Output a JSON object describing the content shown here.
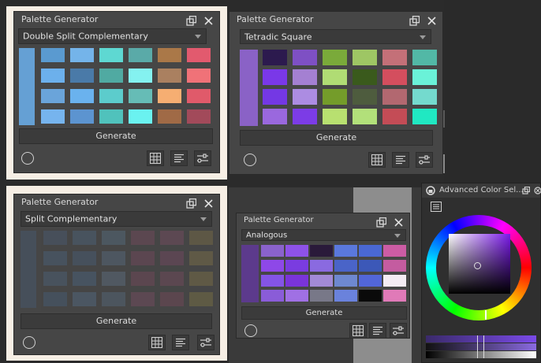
{
  "panels": [
    {
      "title": "Palette Generator",
      "harmony": "Double Split Complementary",
      "generate_label": "Generate",
      "first_color": "#65a0d4",
      "colors": [
        [
          "#5a9ad0",
          "#74b4ea",
          "#5ed8d2",
          "#5aaaa8",
          "#aa7848",
          "#e25a6e"
        ],
        [
          "#6cb0ec",
          "#4a7aa8",
          "#50aaa2",
          "#84f2f0",
          "#aa8060",
          "#f07278"
        ],
        [
          "#6aa4da",
          "#6ab2ee",
          "#5ccccc",
          "#66bcb6",
          "#f6ae72",
          "#e05a6a"
        ],
        [
          "#76b4ee",
          "#5c94d0",
          "#50c2bc",
          "#6af2f0",
          "#a06a46",
          "#a24a5a"
        ]
      ]
    },
    {
      "title": "Palette Generator",
      "harmony": "Tetradic Square",
      "generate_label": "Generate",
      "first_color": "#8a62c6",
      "colors": [
        [
          "#2c1a4e",
          "#7e50c4",
          "#7aaa3a",
          "#9ec664",
          "#c47078",
          "#52b8a6"
        ],
        [
          "#7a38e8",
          "#a480d2",
          "#b0dc74",
          "#3a5a1c",
          "#d44e5e",
          "#6af2d8"
        ],
        [
          "#7438e4",
          "#ac8ce2",
          "#749c2a",
          "#4e5c3e",
          "#b26870",
          "#74dace"
        ],
        [
          "#9a68de",
          "#7c3ce6",
          "#b8e070",
          "#b2e07a",
          "#c44c56",
          "#20e8c2"
        ]
      ]
    },
    {
      "title": "Palette Generator",
      "harmony": "Split Complementary",
      "generate_label": "Generate",
      "first_color": "#476c98",
      "colors": [
        [
          "#4c6e98",
          "#507ea6",
          "#608ab0",
          "#9c4c70",
          "#a05078",
          "#a48c46"
        ],
        [
          "#4c78a8",
          "#4870a0",
          "#6488b0",
          "#9c4a72",
          "#9c4878",
          "#aa9448"
        ],
        [
          "#5078a4",
          "#4c7cae",
          "#7090b4",
          "#9a4a6e",
          "#9c4c72",
          "#aa9446"
        ],
        [
          "#4670a0",
          "#5c88b8",
          "#6082a8",
          "#a0507a",
          "#9a4a6a",
          "#a89842"
        ]
      ]
    },
    {
      "title": "Palette Generator",
      "harmony": "Analogous",
      "generate_label": "Generate",
      "first_color": "#5c3a8c",
      "colors": [
        [
          "#8a62cc",
          "#8e52e8",
          "#2a1a3a",
          "#5a78dc",
          "#4a68d4",
          "#cc5ca4"
        ],
        [
          "#8e48e8",
          "#7a3ce0",
          "#8a6ae0",
          "#4a64c8",
          "#3c58b8",
          "#c45ca0"
        ],
        [
          "#8454e6",
          "#7a34da",
          "#a28ad6",
          "#6e88d0",
          "#5266d8",
          "#f4ecf4"
        ],
        [
          "#8a5cd8",
          "#a070e4",
          "#787888",
          "#6a82dc",
          "#0a0a0a",
          "#e07ab8"
        ]
      ]
    }
  ],
  "advanced": {
    "title": "Advanced Color Sel..."
  }
}
